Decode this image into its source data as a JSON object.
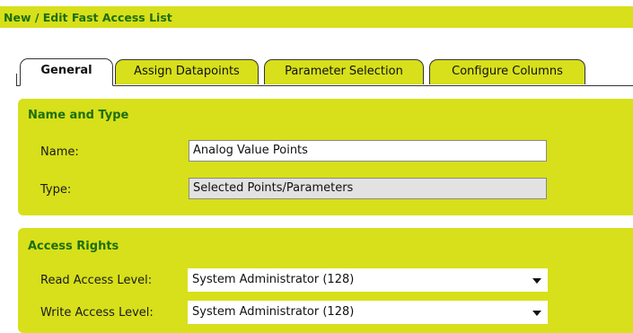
{
  "window": {
    "title": "New / Edit Fast Access List"
  },
  "tabs": [
    {
      "label": "General",
      "active": true
    },
    {
      "label": "Assign Datapoints",
      "active": false
    },
    {
      "label": "Parameter Selection",
      "active": false
    },
    {
      "label": "Configure Columns",
      "active": false
    }
  ],
  "name_type": {
    "heading": "Name and Type",
    "name_label": "Name:",
    "name_value": "Analog Value Points",
    "type_label": "Type:",
    "type_value": "Selected Points/Parameters"
  },
  "access_rights": {
    "heading": "Access Rights",
    "read_label": "Read Access Level:",
    "read_value": "System Administrator (128)",
    "write_label": "Write Access Level:",
    "write_value": "System Administrator (128)"
  },
  "colors": {
    "panel_background": "#d7e01a",
    "heading_text": "#1e6e0e",
    "readonly_field": "#e2e2e2"
  },
  "icons": {
    "read_dropdown": "chevron-down-icon",
    "write_dropdown": "chevron-down-icon"
  }
}
